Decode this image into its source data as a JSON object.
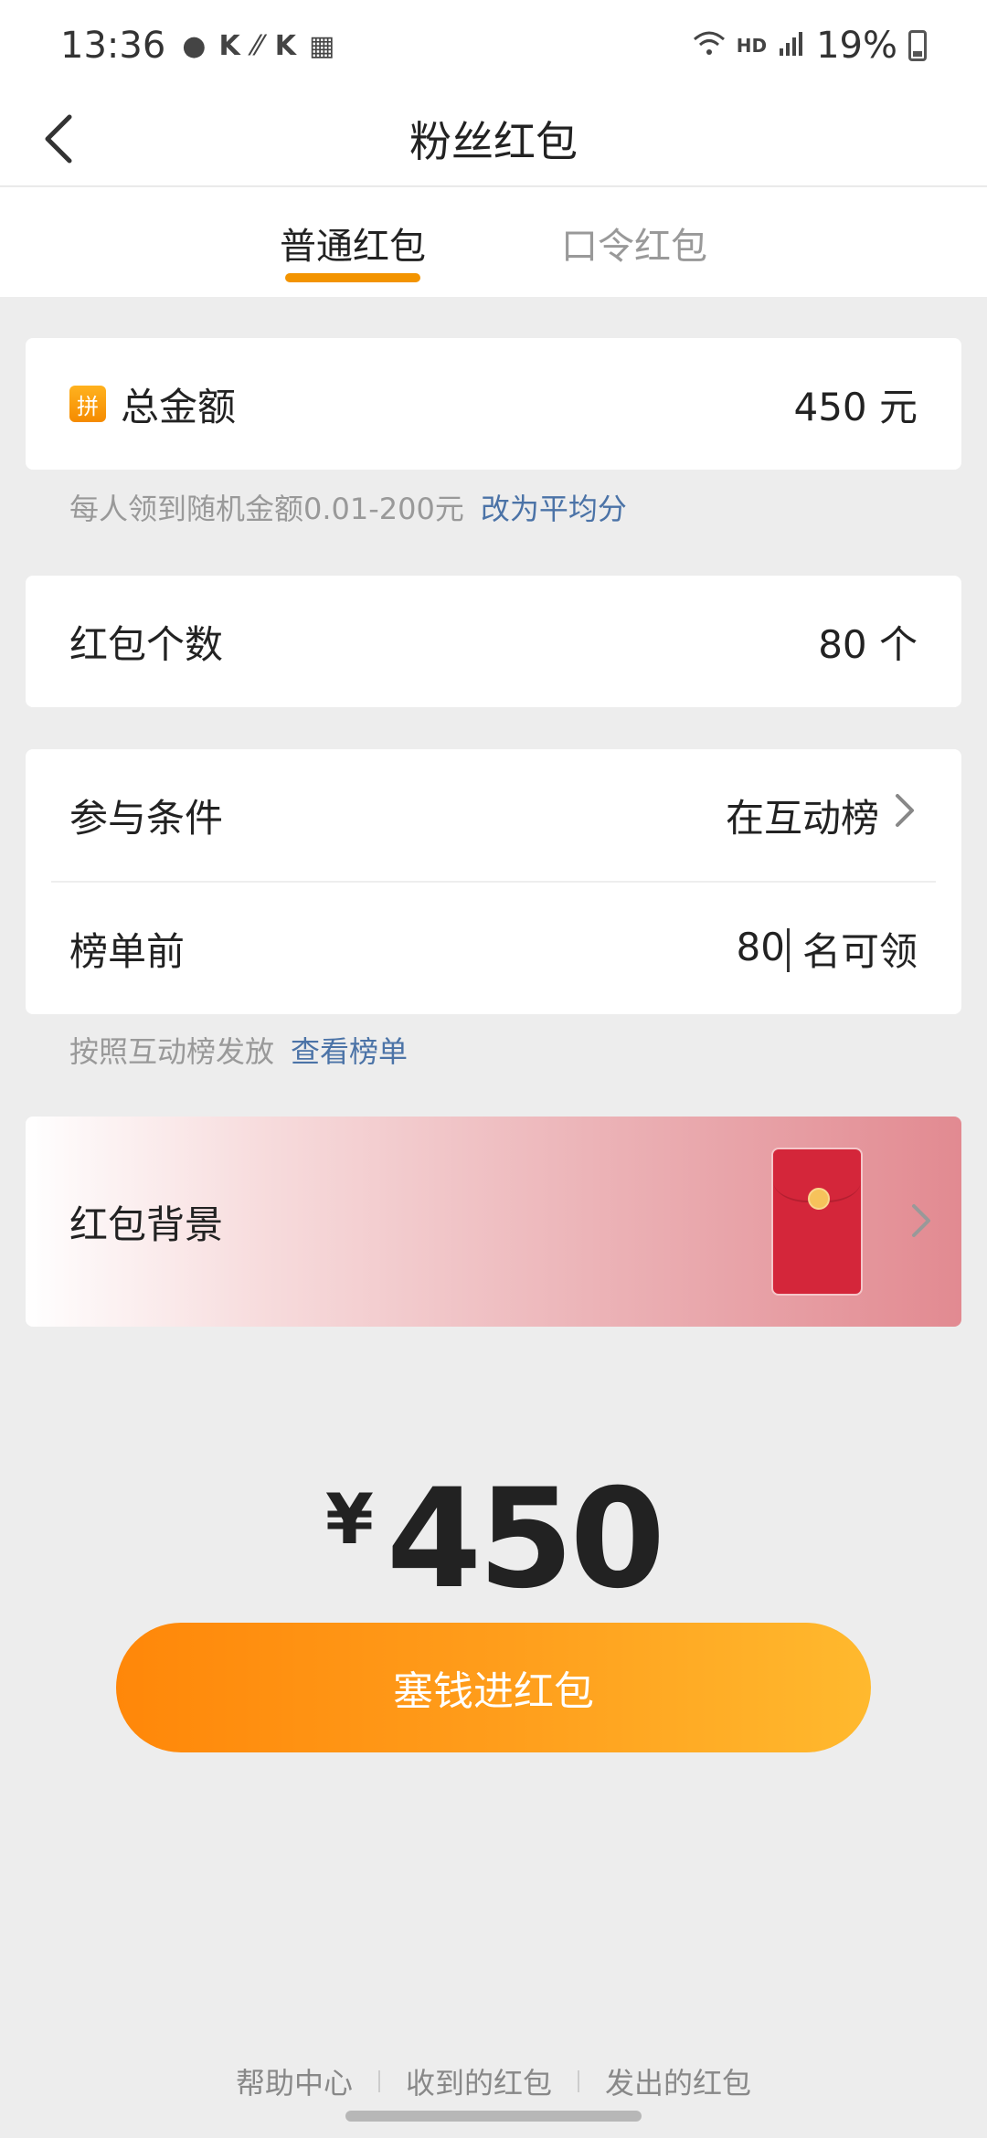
{
  "status_bar": {
    "time": "13:36",
    "notification_icons": [
      "chat-icon",
      "k-icon",
      "signal-slash-icon",
      "k-icon",
      "image-icon"
    ],
    "hd": "HD",
    "battery": "19%"
  },
  "header": {
    "title": "粉丝红包"
  },
  "tabs": [
    {
      "label": "普通红包",
      "active": true
    },
    {
      "label": "口令红包",
      "active": false
    }
  ],
  "total": {
    "badge": "拼",
    "label": "总金额",
    "value": "450 元"
  },
  "total_hint": {
    "text": "每人领到随机金额0.01-200元",
    "link": "改为平均分"
  },
  "count": {
    "label": "红包个数",
    "value": "80 个"
  },
  "conditions": {
    "label": "参与条件",
    "value": "在互动榜"
  },
  "rank": {
    "label": "榜单前",
    "number": "80",
    "suffix": "名可领"
  },
  "rank_hint": {
    "text": "按照互动榜发放",
    "link": "查看榜单"
  },
  "background": {
    "label": "红包背景"
  },
  "amount": {
    "currency": "¥",
    "value": "450"
  },
  "submit": {
    "label": "塞钱进红包"
  },
  "footer": {
    "links": [
      "帮助中心",
      "收到的红包",
      "发出的红包"
    ]
  },
  "colors": {
    "accent": "#f39400",
    "link": "#4b73a7",
    "envelope": "#d4263a"
  }
}
